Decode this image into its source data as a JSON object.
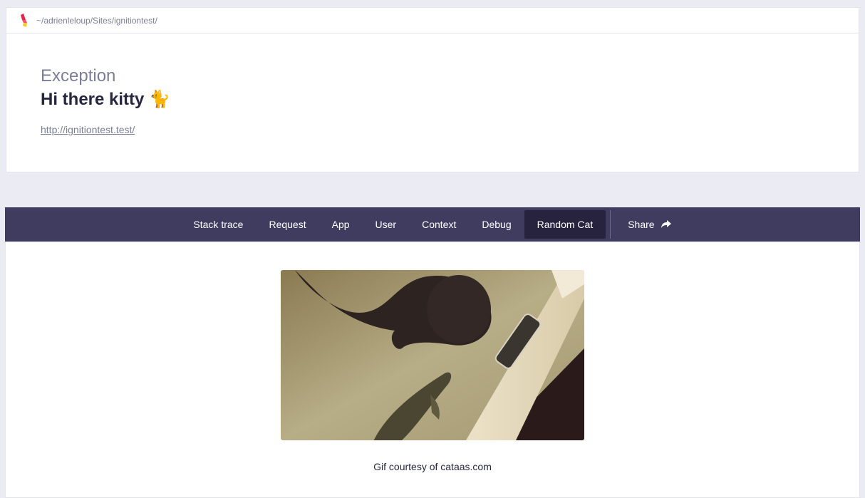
{
  "topbar": {
    "path": "~/adrienleloup/Sites/ignitiontest/"
  },
  "exception": {
    "class": "Exception",
    "message": "Hi there kitty 🐈",
    "url": "http://ignitiontest.test/"
  },
  "tabs": [
    {
      "label": "Stack trace"
    },
    {
      "label": "Request"
    },
    {
      "label": "App"
    },
    {
      "label": "User"
    },
    {
      "label": "Context"
    },
    {
      "label": "Debug"
    },
    {
      "label": "Random Cat",
      "active": true
    }
  ],
  "share": {
    "label": "Share",
    "icon": "share-arrow-icon"
  },
  "random_cat": {
    "image": "cat-and-fish-gif",
    "caption": "Gif courtesy of cataas.com"
  },
  "colors": {
    "background": "#eaebf3",
    "tabbar": "#403c60",
    "tab_active": "#27233f",
    "title": "#262640",
    "muted": "#7b7e98"
  }
}
